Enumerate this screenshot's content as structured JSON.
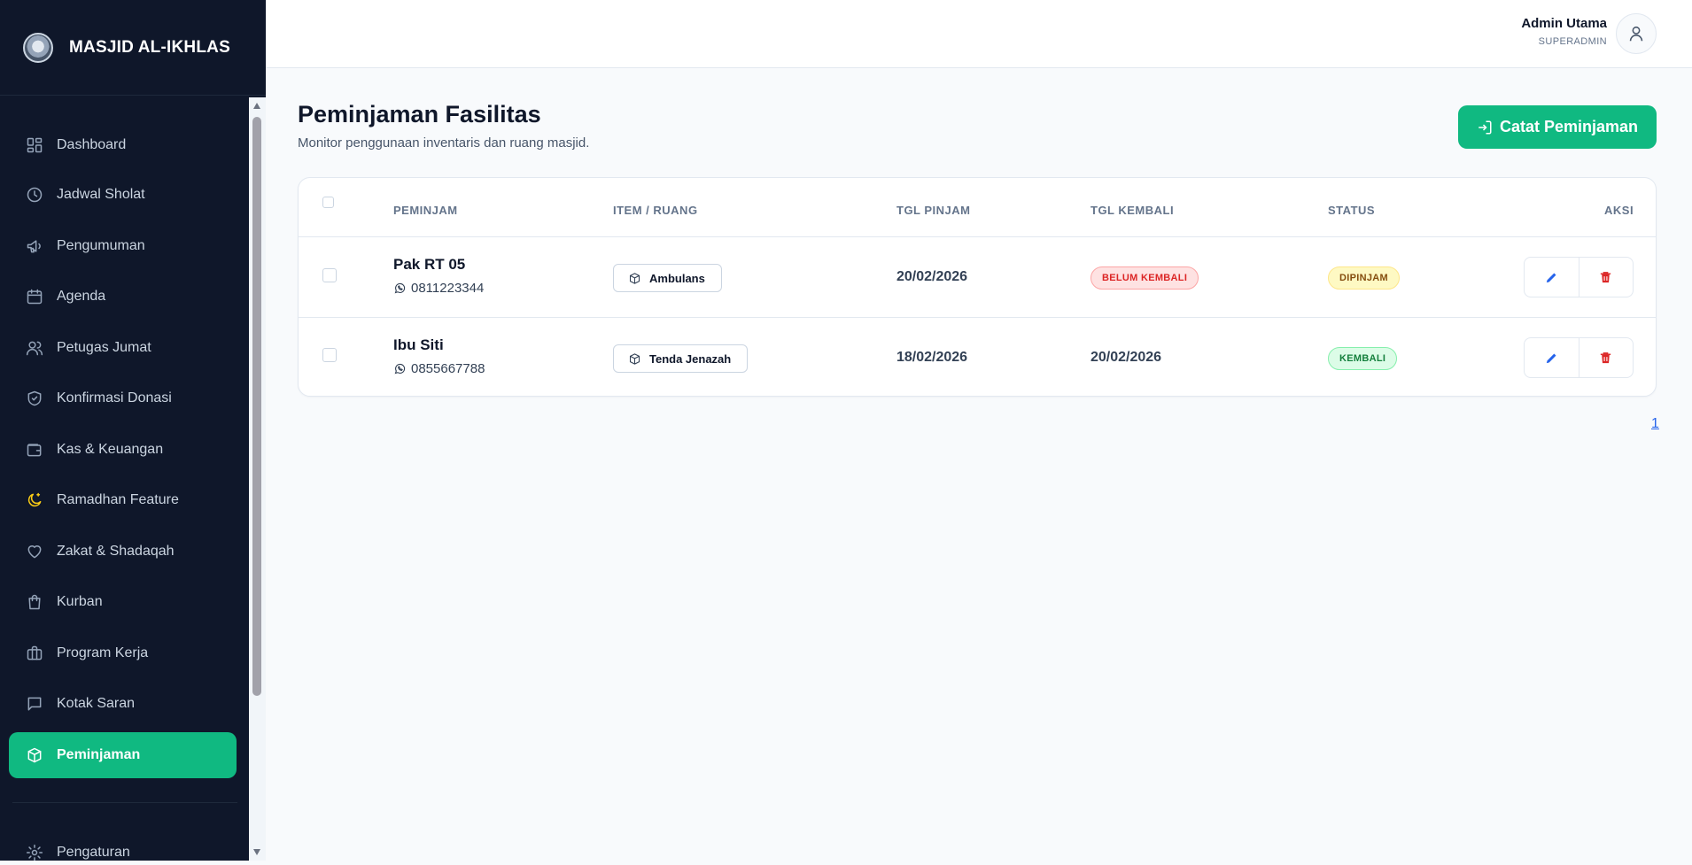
{
  "brand": {
    "name": "MASJID AL-IKHLAS"
  },
  "sidebar": {
    "items": [
      {
        "label": "Dashboard",
        "icon": "dashboard-icon"
      },
      {
        "label": "Jadwal Sholat",
        "icon": "clock-icon"
      },
      {
        "label": "Pengumuman",
        "icon": "megaphone-icon"
      },
      {
        "label": "Agenda",
        "icon": "calendar-icon"
      },
      {
        "label": "Petugas Jumat",
        "icon": "users-icon"
      },
      {
        "label": "Konfirmasi Donasi",
        "icon": "shield-check-icon"
      },
      {
        "label": "Kas & Keuangan",
        "icon": "wallet-icon"
      },
      {
        "label": "Ramadhan Feature",
        "icon": "moon-icon"
      },
      {
        "label": "Zakat & Shadaqah",
        "icon": "heart-icon"
      },
      {
        "label": "Kurban",
        "icon": "bag-icon"
      },
      {
        "label": "Program Kerja",
        "icon": "briefcase-icon"
      },
      {
        "label": "Kotak Saran",
        "icon": "message-icon"
      },
      {
        "label": "Peminjaman",
        "icon": "box-icon",
        "active": true
      }
    ],
    "settings": {
      "label": "Pengaturan",
      "icon": "gear-icon"
    }
  },
  "header": {
    "user_name": "Admin Utama",
    "user_role": "SUPERADMIN"
  },
  "page": {
    "title": "Peminjaman Fasilitas",
    "subtitle": "Monitor penggunaan inventaris dan ruang masjid.",
    "add_button": "Catat Peminjaman"
  },
  "table": {
    "columns": [
      "PEMINJAM",
      "ITEM / RUANG",
      "TGL PINJAM",
      "TGL KEMBALI",
      "STATUS",
      "AKSI"
    ],
    "rows": [
      {
        "name": "Pak RT 05",
        "phone": "0811223344",
        "item": "Ambulans",
        "tgl_pinjam": "20/02/2026",
        "tgl_kembali": "BELUM KEMBALI",
        "status": "DIPINJAM"
      },
      {
        "name": "Ibu Siti",
        "phone": "0855667788",
        "item": "Tenda Jenazah",
        "tgl_pinjam": "18/02/2026",
        "tgl_kembali": "20/02/2026",
        "status": "KEMBALI"
      }
    ]
  },
  "pagination": {
    "current": "1"
  },
  "colors": {
    "accent": "#10b981",
    "sidebar_bg": "#0f172a",
    "edit": "#2563eb",
    "delete": "#dc2626"
  }
}
